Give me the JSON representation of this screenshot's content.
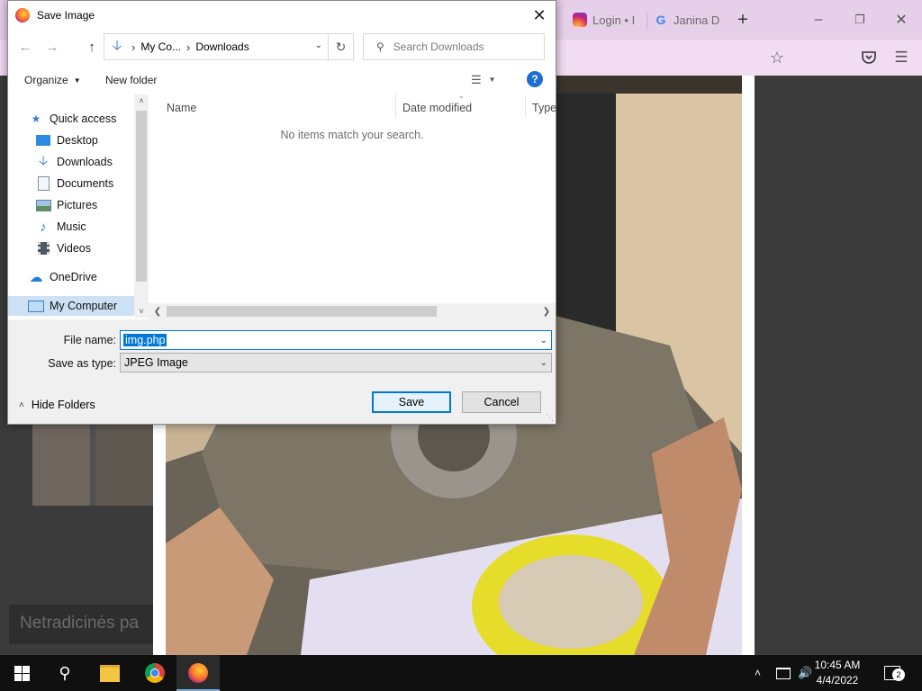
{
  "browser": {
    "tabs": [
      {
        "label": "Login • I",
        "icon": "instagram-icon"
      },
      {
        "label": "Janina D",
        "icon": "google-icon"
      }
    ],
    "new_tab_symbol": "+"
  },
  "background": {
    "left_text": "Netradicinės pa"
  },
  "dialog": {
    "title": "Save Image",
    "address": {
      "parent": "My Co...",
      "current": "Downloads"
    },
    "search_placeholder": "Search Downloads",
    "toolbar": {
      "organize": "Organize",
      "new_folder": "New folder"
    },
    "nav": [
      {
        "label": "Quick access",
        "icon": "star-icon",
        "pinned": false
      },
      {
        "label": "Desktop",
        "icon": "desktop-icon",
        "pinned": true
      },
      {
        "label": "Downloads",
        "icon": "download-icon",
        "pinned": true
      },
      {
        "label": "Documents",
        "icon": "document-icon",
        "pinned": true
      },
      {
        "label": "Pictures",
        "icon": "pictures-icon",
        "pinned": true
      },
      {
        "label": "Music",
        "icon": "music-icon",
        "pinned": false
      },
      {
        "label": "Videos",
        "icon": "video-icon",
        "pinned": false
      },
      {
        "label": "OneDrive",
        "icon": "cloud-icon",
        "pinned": false
      },
      {
        "label": "My Computer",
        "icon": "computer-icon",
        "pinned": false,
        "selected": true
      }
    ],
    "columns": [
      "Name",
      "Date modified",
      "Type"
    ],
    "empty_message": "No items match your search.",
    "file_name_label": "File name:",
    "file_name_value": "img.php",
    "save_type_label": "Save as type:",
    "save_type_value": "JPEG Image",
    "hide_folders": "Hide Folders",
    "save_button": "Save",
    "cancel_button": "Cancel"
  },
  "taskbar": {
    "time": "10:45 AM",
    "date": "4/4/2022",
    "notification_count": "2"
  }
}
